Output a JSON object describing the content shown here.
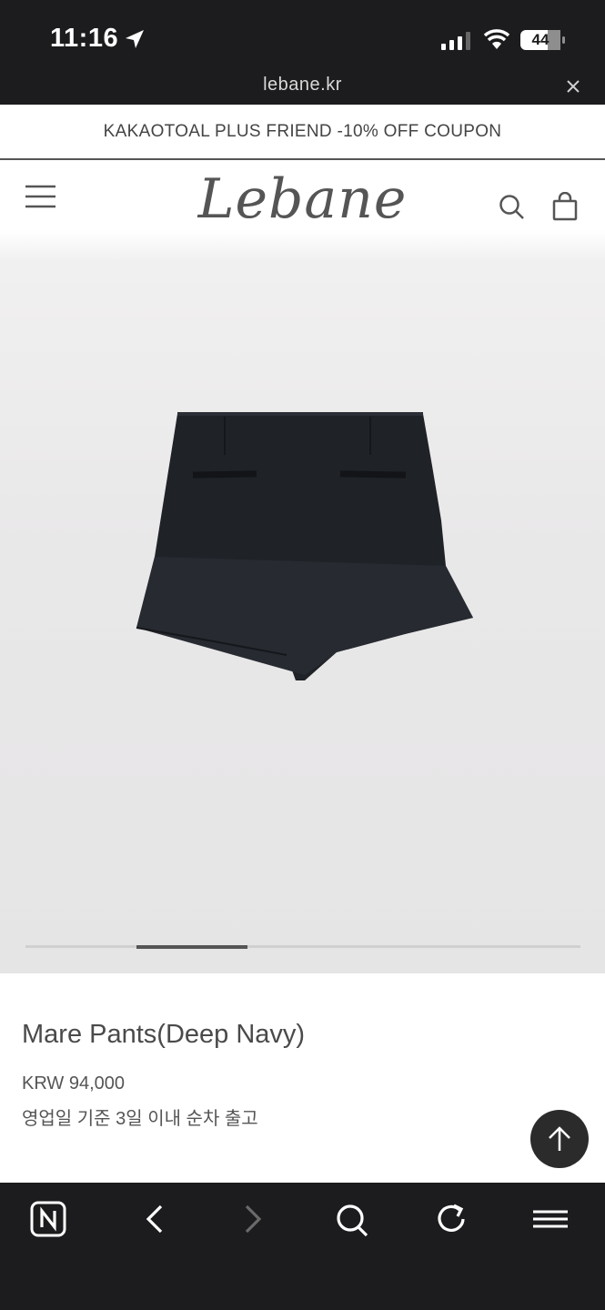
{
  "status_bar": {
    "time": "11:16",
    "battery": "44"
  },
  "browser": {
    "url": "lebane.kr"
  },
  "promo": {
    "text": "KAKAOTOAL PLUS FRIEND -10% OFF COUPON"
  },
  "header": {
    "logo": "Lebane"
  },
  "product": {
    "name": "Mare Pants(Deep Navy)",
    "price": "KRW 94,000",
    "shipping": "영업일 기준 3일 이내 순차 출고",
    "image_slide_progress": "2 of 5"
  },
  "colors": {
    "dark_bar": "#1c1c1e",
    "product_color": "#1f2227",
    "text": "#4a4a4a"
  }
}
